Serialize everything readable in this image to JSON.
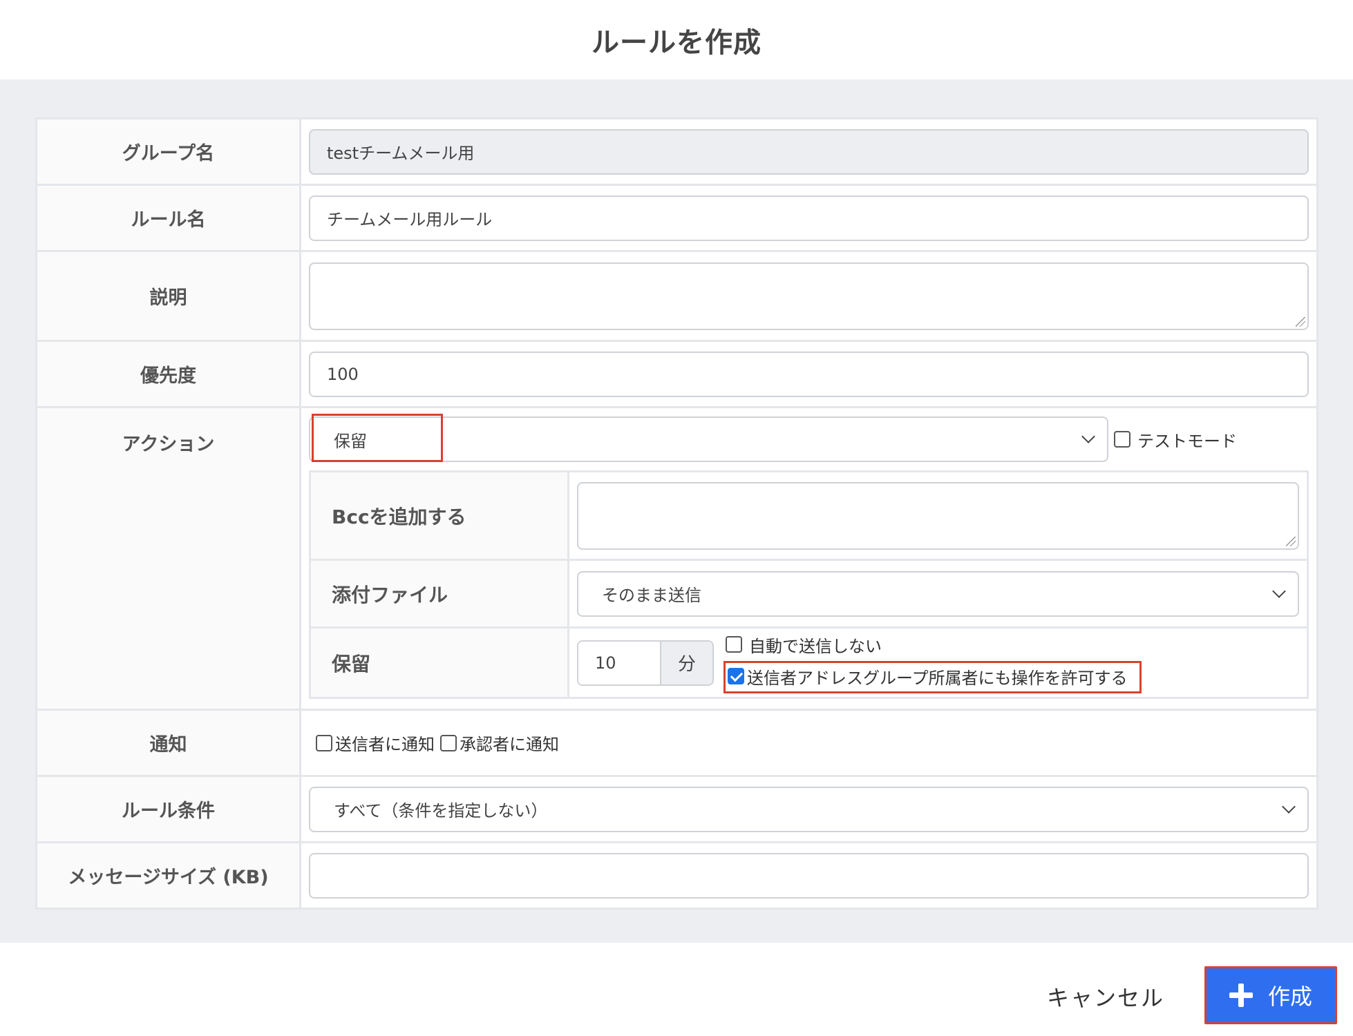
{
  "dialog": {
    "title": "ルールを作成"
  },
  "form": {
    "group_name": {
      "label": "グループ名",
      "value": "testチームメール用"
    },
    "rule_name": {
      "label": "ルール名",
      "value": "チームメール用ルール"
    },
    "description": {
      "label": "説明",
      "value": ""
    },
    "priority": {
      "label": "優先度",
      "value": "100"
    },
    "action": {
      "label": "アクション",
      "selected": "保留",
      "test_mode_label": "テストモード",
      "test_mode_checked": false,
      "bcc": {
        "label": "Bccを追加する",
        "value": ""
      },
      "attachment": {
        "label": "添付ファイル",
        "selected": "そのまま送信"
      },
      "hold": {
        "label": "保留",
        "minutes": "10",
        "unit": "分",
        "no_auto_send_label": "自動で送信しない",
        "no_auto_send_checked": false,
        "allow_sender_group_label": "送信者アドレスグループ所属者にも操作を許可する",
        "allow_sender_group_checked": true
      }
    },
    "notification": {
      "label": "通知",
      "notify_sender_label": "送信者に通知",
      "notify_approver_label": "承認者に通知"
    },
    "rule_condition": {
      "label": "ルール条件",
      "selected": "すべて（条件を指定しない）"
    },
    "message_size": {
      "label": "メッセージサイズ (KB)",
      "value": ""
    }
  },
  "footer": {
    "cancel_label": "キャンセル",
    "create_label": "作成"
  }
}
